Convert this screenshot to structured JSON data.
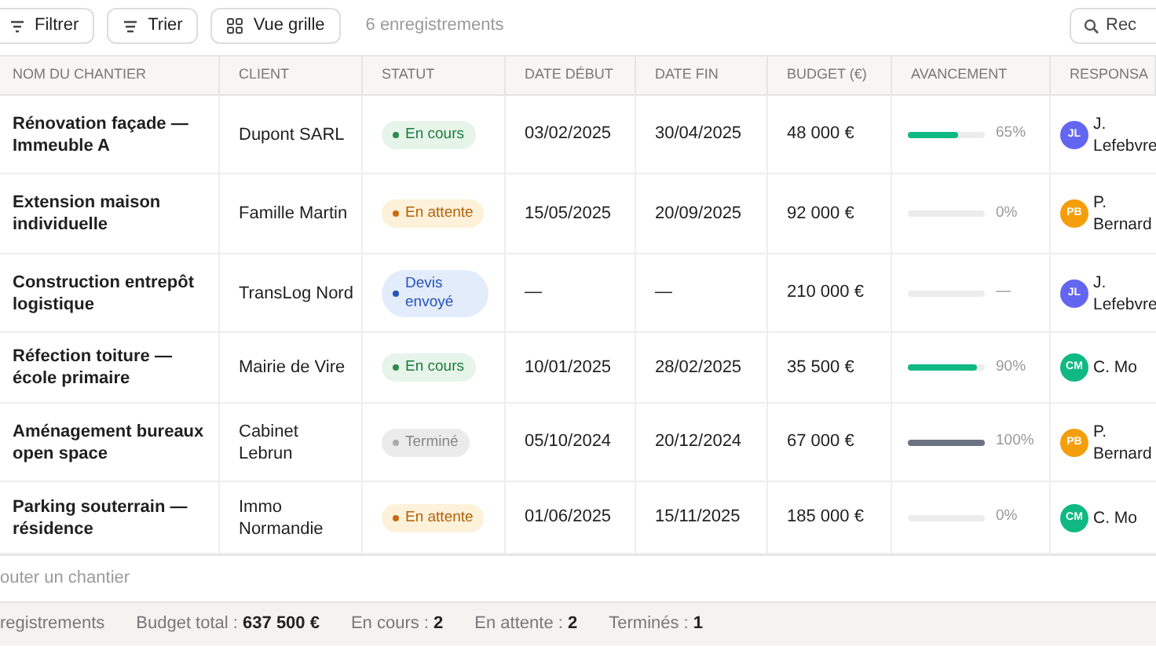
{
  "toolbar": {
    "buttons": [
      {
        "label": "Filtrer"
      },
      {
        "label": "Trier"
      },
      {
        "label": "Vue grille"
      }
    ],
    "count": "6 enregistrements",
    "search": {
      "placeholder": "Rec"
    }
  },
  "table": {
    "columns": [
      "NOM DU CHANTIER",
      "CLIENT",
      "STATUT",
      "DATE DÉBUT",
      "DATE FIN",
      "BUDGET (€)",
      "AVANCEMENT",
      "RESPONSA"
    ],
    "rows": [
      {
        "name": "Rénovation façade — Immeuble A",
        "client": "Dupont SARL",
        "status": {
          "label": "En cours",
          "kind": "active"
        },
        "start": "03/02/2025",
        "end": "30/04/2025",
        "budget": "48 000 €",
        "progress": {
          "level": 0.65,
          "reading": "65%",
          "color": "#10b981"
        },
        "owner": {
          "initials": "JL",
          "name": "J. Lefebvre",
          "color": "#6366f1"
        }
      },
      {
        "name": "Extension maison individuelle",
        "client": "Famille Martin",
        "status": {
          "label": "En attente",
          "kind": "pending"
        },
        "start": "15/05/2025",
        "end": "20/09/2025",
        "budget": "92 000 €",
        "progress": {
          "level": 0,
          "reading": "0%"
        },
        "owner": {
          "initials": "PB",
          "name": "P. Bernard",
          "color": "#f59e0b"
        }
      },
      {
        "name": "Construction entrepôt logistique",
        "client": "TransLog Nord",
        "status": {
          "label": "Devis envoyé",
          "kind": "quote"
        },
        "start": "—",
        "end": "—",
        "budget": "210 000 €",
        "progress": {
          "level": 0,
          "reading": "—"
        },
        "owner": {
          "initials": "JL",
          "name": "J. Lefebvre",
          "color": "#6366f1"
        }
      },
      {
        "name": "Réfection toiture — école primaire",
        "client": "Mairie de Vire",
        "status": {
          "label": "En cours",
          "kind": "active"
        },
        "start": "10/01/2025",
        "end": "28/02/2025",
        "budget": "35 500 €",
        "progress": {
          "level": 0.9,
          "reading": "90%",
          "color": "#10b981"
        },
        "owner": {
          "initials": "CM",
          "name": "C. Mo",
          "color": "#10b981"
        }
      },
      {
        "name": "Aménagement bureaux open space",
        "client": "Cabinet Lebrun",
        "status": {
          "label": "Terminé",
          "kind": "done"
        },
        "start": "05/10/2024",
        "end": "20/12/2024",
        "budget": "67 000 €",
        "progress": {
          "level": 1,
          "reading": "100%",
          "color": "#6b7280"
        },
        "owner": {
          "initials": "PB",
          "name": "P. Bernard",
          "color": "#f59e0b"
        }
      },
      {
        "name": "Parking souterrain — résidence",
        "client": "Immo Normandie",
        "status": {
          "label": "En attente",
          "kind": "pending"
        },
        "start": "01/06/2025",
        "end": "15/11/2025",
        "budget": "185 000 €",
        "progress": {
          "level": 0,
          "reading": "0%"
        },
        "owner": {
          "initials": "CM",
          "name": "C. Mo",
          "color": "#10b981"
        }
      }
    ],
    "add_row": "outer un chantier"
  },
  "status_bar": [
    "registrements",
    "Budget total : **637 500 €**",
    "En cours : **2**",
    "En attente : **2**",
    "Terminés : **1**"
  ]
}
